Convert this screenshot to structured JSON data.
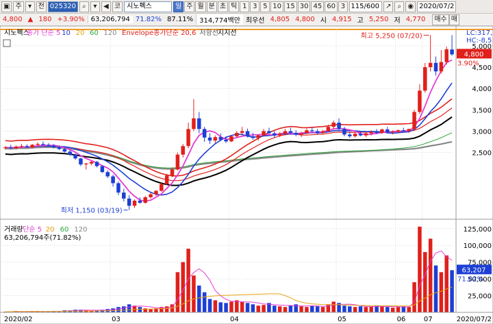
{
  "toolbar": {
    "buttons": [
      "▣",
      "주",
      "▾",
      "전"
    ],
    "code": "025320",
    "search_icon": "magnifier-icon",
    "buttons2": [
      "▾",
      "◀",
      "코"
    ],
    "stock_name": "시노펙스",
    "period_tabs": [
      "일",
      "주",
      "월",
      "분",
      "초",
      "틱",
      "1",
      "3",
      "5",
      "10",
      "15",
      "30",
      "45",
      "60",
      "3"
    ],
    "selected_period": "일",
    "page_count": "115/600",
    "tools": [
      "📈",
      "🔍",
      "👁"
    ],
    "date": "2020/07/2"
  },
  "quote": {
    "price": "4,800",
    "direction": "▲",
    "change": "180",
    "change_pct": "+3.90%",
    "volume": "63,206,794",
    "vol_ratio": "71.82%",
    "turnover": "87.11%",
    "amount": "314,774백만",
    "broker": "최우선",
    "ask": "4,805",
    "bid": "4,800",
    "open_label": "시",
    "open": "4,915",
    "high_label": "고",
    "high": "5,250",
    "low_label": "저",
    "low": "4,770",
    "side_buttons": [
      "매수",
      "매"
    ]
  },
  "price_panel": {
    "legend": [
      {
        "text": "시노펙스",
        "color": "#000000"
      },
      {
        "text": "종가 단순 5",
        "color": "#e43bd6"
      },
      {
        "text": "10",
        "color": "#1d3fd6"
      },
      {
        "text": "20",
        "color": "#e6a313"
      },
      {
        "text": "60",
        "color": "#2da63a"
      },
      {
        "text": "120",
        "color": "#888888"
      },
      {
        "text": "Envelope종가단순 20,6",
        "color": "#e0201b"
      },
      {
        "text": "저항선",
        "color": "#555555"
      },
      {
        "text": "지지선",
        "color": "#000000"
      }
    ],
    "yaxis_top_label": "LC:317,",
    "yaxis_top_label2": "HC:-8,5",
    "ticks": [
      "5,000",
      "4,500",
      "4,000",
      "3,500",
      "3,000",
      "2,500"
    ],
    "last_price": "4,800",
    "last_pct": "3.90%",
    "max_label": "최고 5,250 (07/20)",
    "min_label": "최저 1,150 (03/19)"
  },
  "volume_panel": {
    "legend": [
      {
        "text": "거래량",
        "color": "#000000"
      },
      {
        "text": "단순 5",
        "color": "#e43bd6"
      },
      {
        "text": "20",
        "color": "#e6a313"
      },
      {
        "text": "60",
        "color": "#2da63a"
      },
      {
        "text": "120",
        "color": "#888888"
      }
    ],
    "readout": "63,206,794주(71.82%)",
    "ticks": [
      "125,000",
      "100,000",
      "75,000",
      "50,000",
      "25,000"
    ],
    "last_volume": "63,207",
    "last_pct": "71.82%"
  },
  "xaxis": [
    "2020/02",
    "03",
    "04",
    "05",
    "06",
    "07",
    "2020/07/2"
  ],
  "colors": {
    "up": "#e0201b",
    "down": "#1d3fd6",
    "accent": "#4a77c9"
  },
  "chart_data": {
    "type": "candlestick",
    "candles": [
      [
        2600,
        2650,
        2560,
        2620
      ],
      [
        2620,
        2680,
        2590,
        2600
      ],
      [
        2600,
        2660,
        2570,
        2640
      ],
      [
        2640,
        2700,
        2600,
        2650
      ],
      [
        2650,
        2690,
        2610,
        2620
      ],
      [
        2620,
        2700,
        2600,
        2680
      ],
      [
        2680,
        2740,
        2650,
        2700
      ],
      [
        2700,
        2760,
        2660,
        2680
      ],
      [
        2680,
        2720,
        2640,
        2660
      ],
      [
        2660,
        2700,
        2600,
        2620
      ],
      [
        2620,
        2660,
        2560,
        2580
      ],
      [
        2580,
        2620,
        2500,
        2520
      ],
      [
        2520,
        2560,
        2420,
        2450
      ],
      [
        2450,
        2480,
        2330,
        2360
      ],
      [
        2360,
        2380,
        2180,
        2220
      ],
      [
        2220,
        2260,
        2100,
        2240
      ],
      [
        2240,
        2300,
        2200,
        2280
      ],
      [
        2280,
        2300,
        2150,
        2180
      ],
      [
        2180,
        2200,
        2020,
        2040
      ],
      [
        2040,
        2080,
        1900,
        1940
      ],
      [
        1940,
        1980,
        1700,
        1780
      ],
      [
        1780,
        1820,
        1500,
        1560
      ],
      [
        1560,
        1650,
        1350,
        1420
      ],
      [
        1420,
        1500,
        1150,
        1250
      ],
      [
        1250,
        1400,
        1200,
        1370
      ],
      [
        1370,
        1450,
        1300,
        1320
      ],
      [
        1320,
        1480,
        1300,
        1450
      ],
      [
        1450,
        1560,
        1420,
        1520
      ],
      [
        1520,
        1620,
        1480,
        1600
      ],
      [
        1600,
        1800,
        1580,
        1760
      ],
      [
        1760,
        2000,
        1740,
        1960
      ],
      [
        1960,
        2150,
        1920,
        2100
      ],
      [
        2100,
        2500,
        2080,
        2450
      ],
      [
        2450,
        2700,
        2380,
        2650
      ],
      [
        2650,
        3200,
        2600,
        3050
      ],
      [
        3050,
        3750,
        3000,
        3300
      ],
      [
        3300,
        3450,
        2950,
        3050
      ],
      [
        3050,
        3100,
        2750,
        2850
      ],
      [
        2850,
        2950,
        2700,
        2780
      ],
      [
        2780,
        2900,
        2720,
        2860
      ],
      [
        2860,
        2950,
        2760,
        2800
      ],
      [
        2800,
        2880,
        2720,
        2760
      ],
      [
        2760,
        2900,
        2740,
        2880
      ],
      [
        2880,
        3000,
        2840,
        2960
      ],
      [
        2960,
        3100,
        2900,
        3000
      ],
      [
        3000,
        3060,
        2850,
        2880
      ],
      [
        2880,
        2960,
        2800,
        2840
      ],
      [
        2840,
        2920,
        2780,
        2900
      ],
      [
        2900,
        3050,
        2880,
        3000
      ],
      [
        3000,
        3080,
        2920,
        2950
      ],
      [
        2950,
        3000,
        2850,
        2900
      ],
      [
        2900,
        2980,
        2860,
        2940
      ],
      [
        2940,
        3050,
        2900,
        3000
      ],
      [
        3000,
        3080,
        2940,
        2960
      ],
      [
        2960,
        3020,
        2880,
        2920
      ],
      [
        2920,
        2980,
        2860,
        2950
      ],
      [
        2950,
        3060,
        2930,
        3020
      ],
      [
        3020,
        3100,
        2960,
        3000
      ],
      [
        3000,
        3050,
        2920,
        2960
      ],
      [
        2960,
        3030,
        2920,
        3000
      ],
      [
        3000,
        3150,
        2980,
        3100
      ],
      [
        3100,
        3250,
        3050,
        3200
      ],
      [
        3200,
        3300,
        3000,
        3050
      ],
      [
        3050,
        3100,
        2880,
        2920
      ],
      [
        2920,
        2980,
        2840,
        2880
      ],
      [
        2880,
        2960,
        2850,
        2940
      ],
      [
        2940,
        3000,
        2880,
        2900
      ],
      [
        2900,
        2970,
        2860,
        2950
      ],
      [
        2950,
        3020,
        2900,
        2980
      ],
      [
        2980,
        3050,
        2930,
        2960
      ],
      [
        2960,
        3060,
        2940,
        3040
      ],
      [
        3040,
        3100,
        2950,
        2970
      ],
      [
        2970,
        3020,
        2920,
        2990
      ],
      [
        2990,
        3040,
        2950,
        3020
      ],
      [
        3020,
        3080,
        2980,
        3000
      ],
      [
        3000,
        3060,
        2960,
        3050
      ],
      [
        3050,
        3500,
        3020,
        3450
      ],
      [
        3450,
        4100,
        3400,
        3950
      ],
      [
        3950,
        4600,
        3900,
        4500
      ],
      [
        4500,
        5250,
        4400,
        4600
      ],
      [
        4600,
        4750,
        4300,
        4400
      ],
      [
        4400,
        4900,
        4350,
        4620
      ],
      [
        4620,
        4980,
        4560,
        4920
      ],
      [
        4915,
        5250,
        4770,
        4800
      ]
    ],
    "volumes": [
      1,
      1,
      2,
      1,
      1,
      2,
      2,
      1,
      1,
      2,
      2,
      3,
      3,
      4,
      4,
      3,
      2,
      3,
      4,
      5,
      6,
      8,
      9,
      12,
      10,
      8,
      6,
      5,
      6,
      8,
      9,
      12,
      60,
      75,
      95,
      55,
      40,
      30,
      20,
      18,
      15,
      14,
      16,
      18,
      16,
      14,
      12,
      10,
      11,
      14,
      10,
      9,
      8,
      10,
      12,
      9,
      8,
      10,
      9,
      8,
      12,
      16,
      14,
      10,
      9,
      8,
      9,
      8,
      9,
      10,
      9,
      8,
      7,
      8,
      9,
      8,
      45,
      128,
      90,
      110,
      70,
      60,
      85,
      63
    ],
    "ylim_price": [
      1000,
      5400
    ],
    "ylim_volume": [
      0,
      135000
    ]
  }
}
